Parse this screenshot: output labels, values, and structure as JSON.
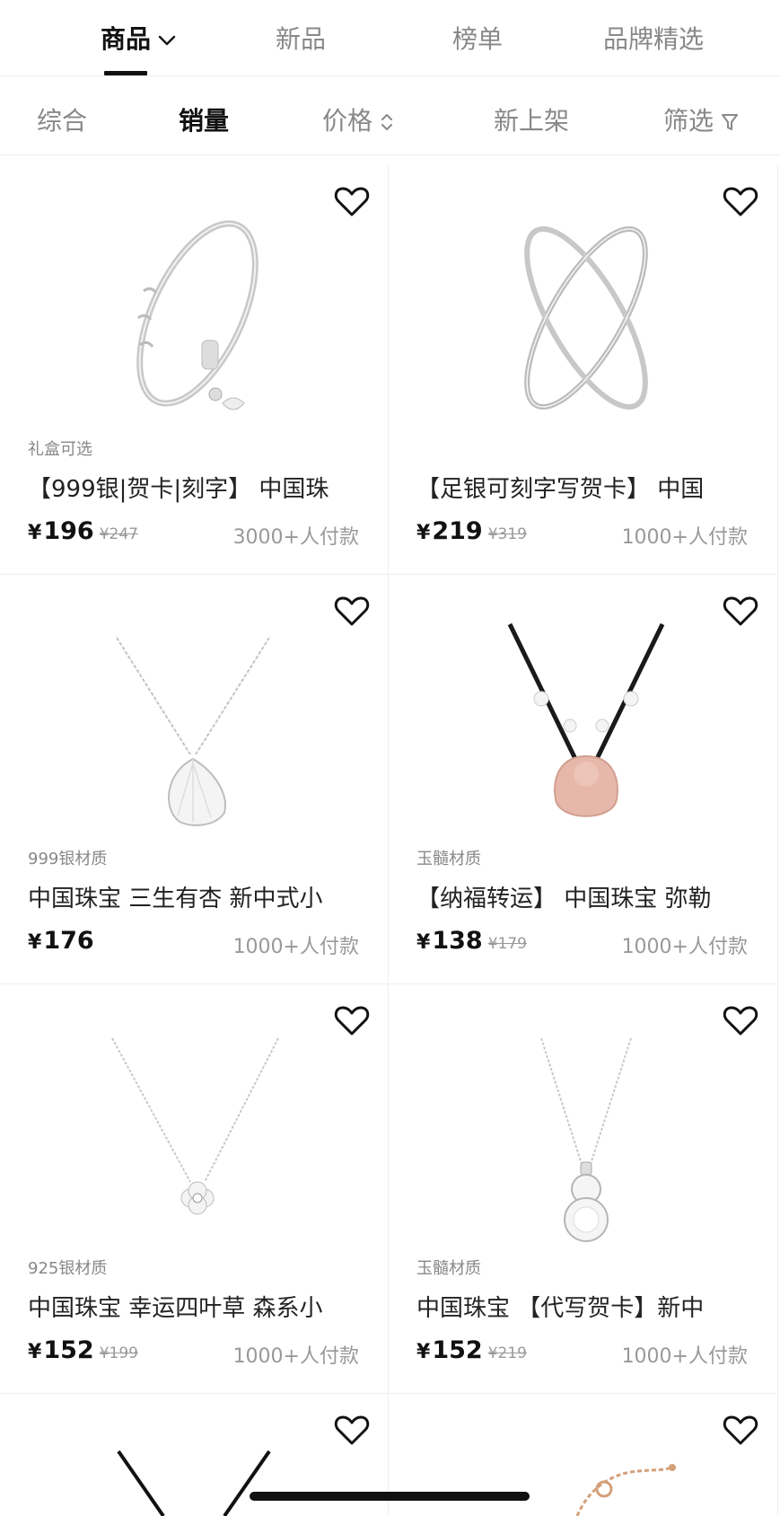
{
  "tabs": {
    "items": [
      {
        "label": "商品",
        "active": true
      },
      {
        "label": "新品",
        "active": false
      },
      {
        "label": "榜单",
        "active": false
      },
      {
        "label": "品牌精选",
        "active": false
      }
    ]
  },
  "sort": {
    "items": [
      {
        "label": "综合",
        "active": false
      },
      {
        "label": "销量",
        "active": true
      },
      {
        "label": "价格",
        "active": false
      },
      {
        "label": "新上架",
        "active": false
      },
      {
        "label": "筛选",
        "active": false
      }
    ]
  },
  "products": [
    {
      "tag": "礼盒可选",
      "title": "【999银|贺卡|刻字】 中国珠",
      "currency": "¥",
      "price": "196",
      "original_price": "¥247",
      "sales": "3000+人付款",
      "image": "bangle-charms"
    },
    {
      "tag": "",
      "title": "【足银可刻字写贺卡】 中国",
      "currency": "¥",
      "price": "219",
      "original_price": "¥319",
      "sales": "1000+人付款",
      "image": "crossed-bangle"
    },
    {
      "tag": "999银材质",
      "title": "中国珠宝 三生有杏 新中式小",
      "currency": "¥",
      "price": "176",
      "original_price": "",
      "sales": "1000+人付款",
      "image": "ginkgo-necklace"
    },
    {
      "tag": "玉髓材质",
      "title": "【纳福转运】 中国珠宝 弥勒",
      "currency": "¥",
      "price": "138",
      "original_price": "¥179",
      "sales": "1000+人付款",
      "image": "buddha-necklace"
    },
    {
      "tag": "925银材质",
      "title": "中国珠宝 幸运四叶草 森系小",
      "currency": "¥",
      "price": "152",
      "original_price": "¥199",
      "sales": "1000+人付款",
      "image": "clover-necklace"
    },
    {
      "tag": "玉髓材质",
      "title": "中国珠宝 【代写贺卡】新中",
      "currency": "¥",
      "price": "152",
      "original_price": "¥219",
      "sales": "1000+人付款",
      "image": "gourd-necklace"
    },
    {
      "tag": "",
      "title": "",
      "currency": "",
      "price": "",
      "original_price": "",
      "sales": "",
      "image": "black-cord-necklace"
    },
    {
      "tag": "",
      "title": "",
      "currency": "",
      "price": "",
      "original_price": "",
      "sales": "",
      "image": "rose-gold-bracelet"
    }
  ],
  "colors": {
    "active": "#111111",
    "inactive": "#888888",
    "muted": "#999999"
  }
}
